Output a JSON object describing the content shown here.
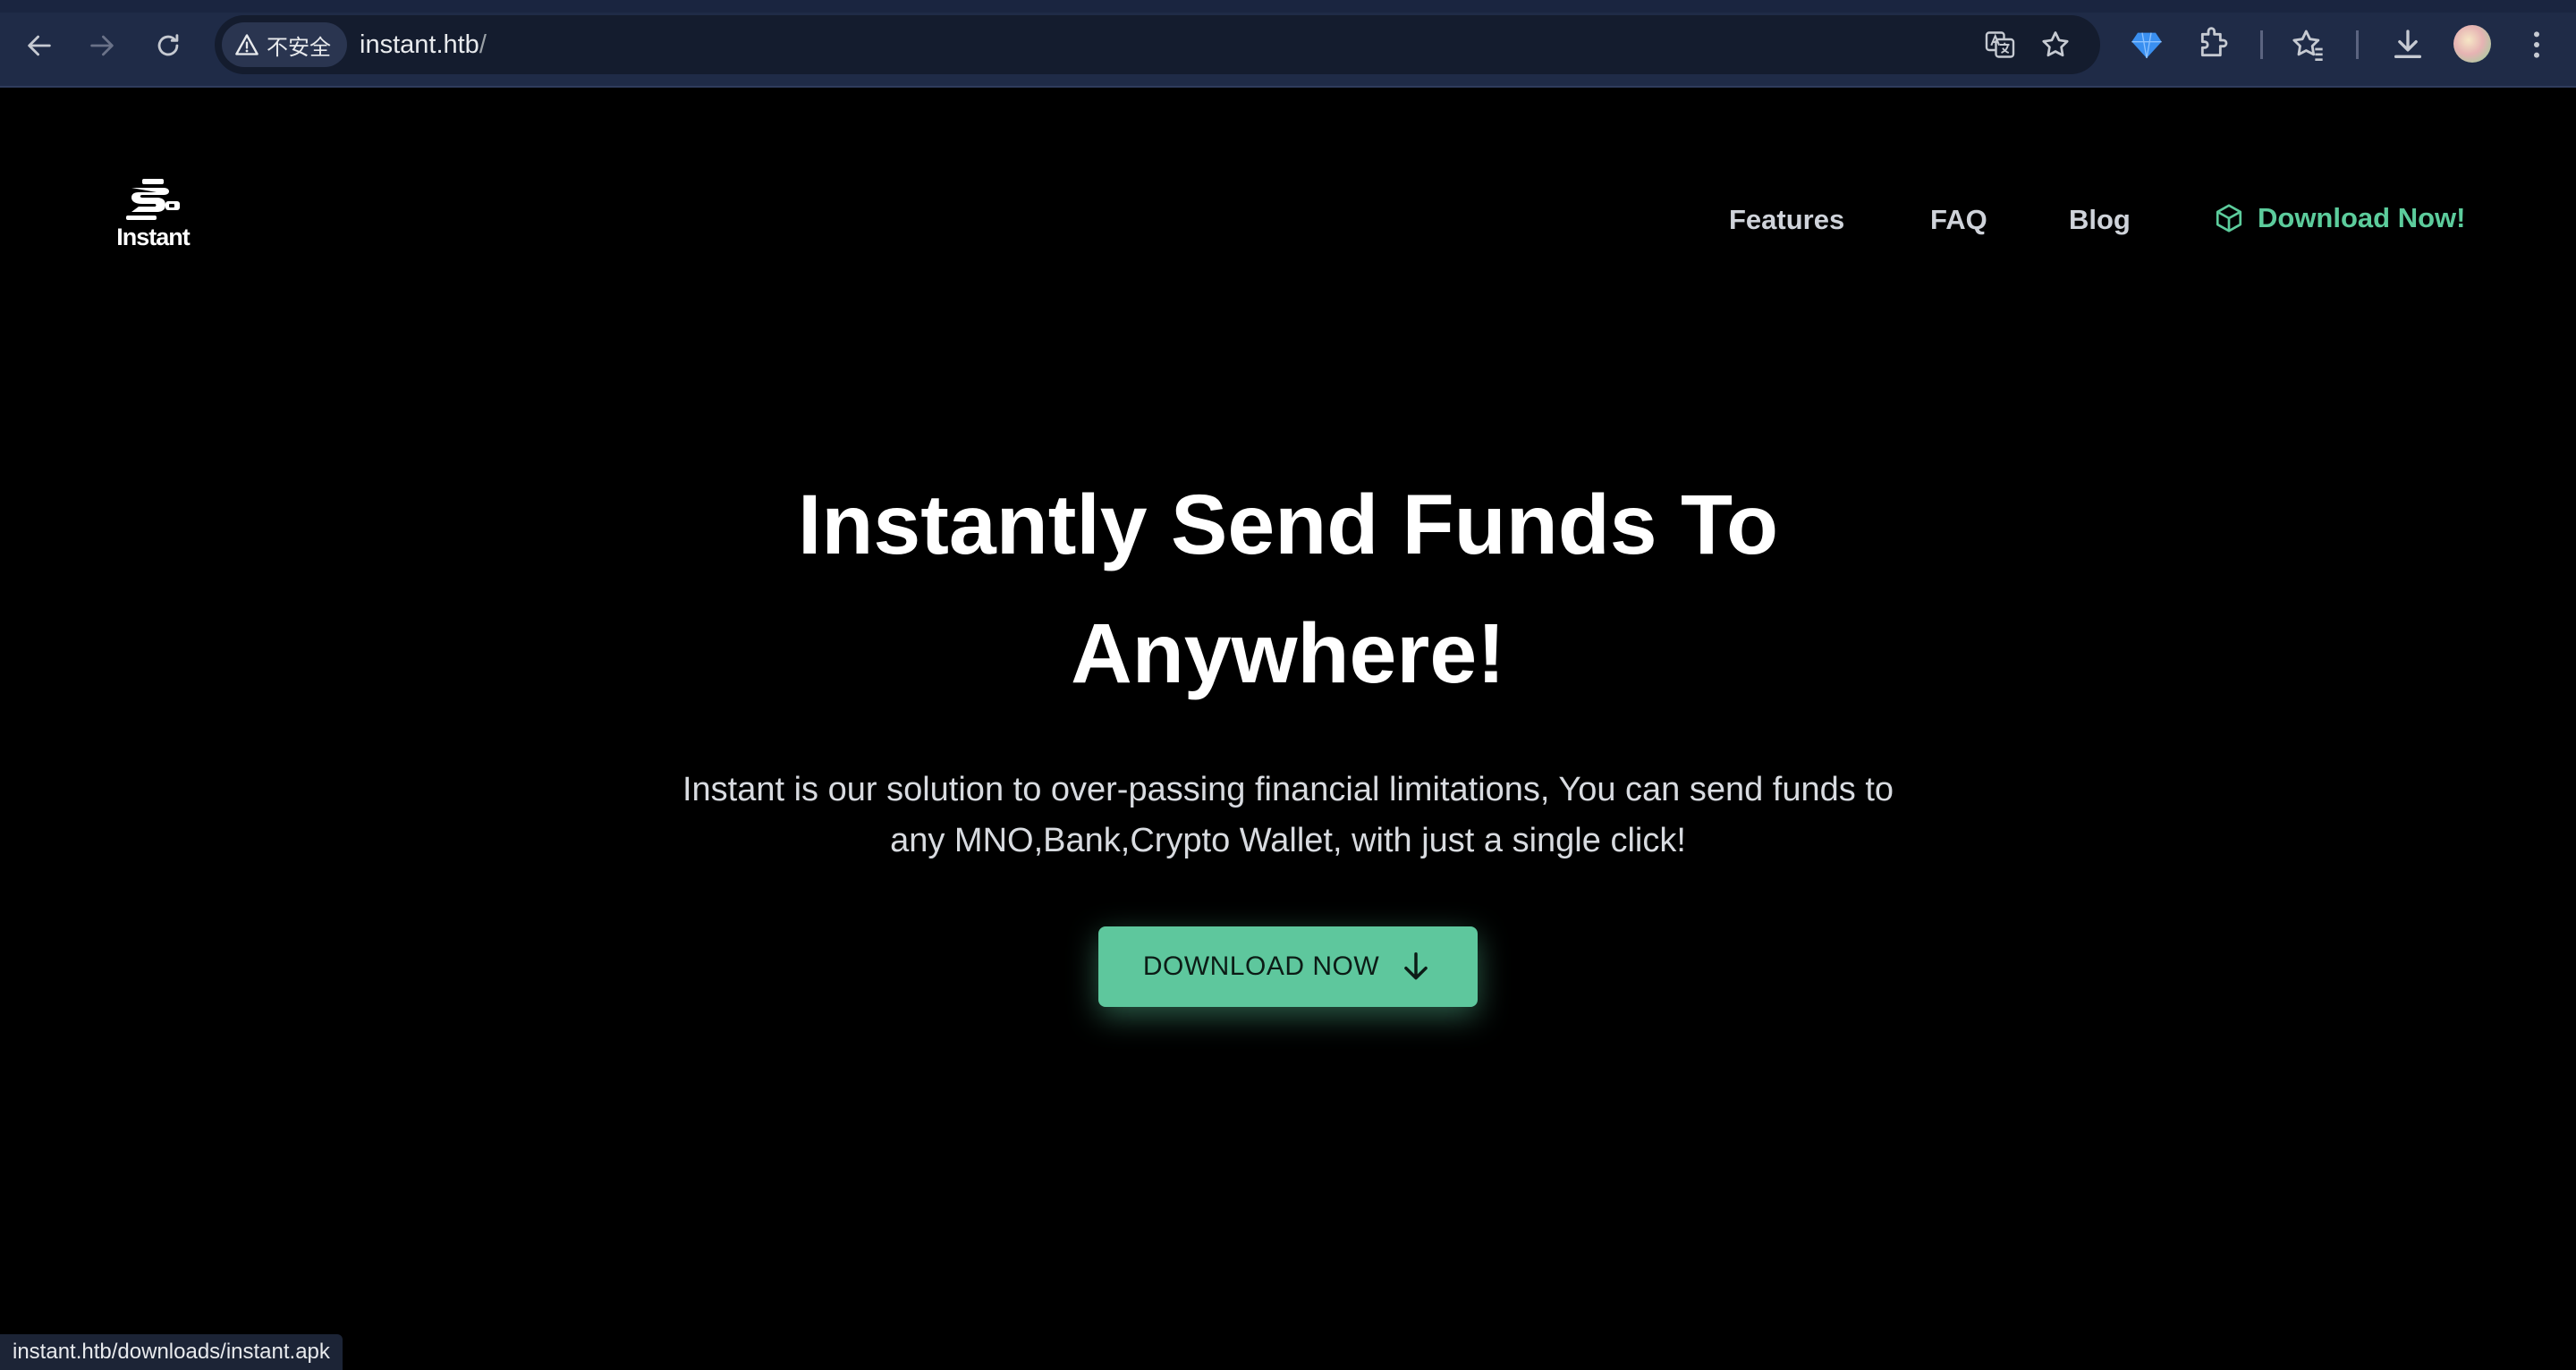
{
  "browser": {
    "security_label": "不安全",
    "url_host": "instant.htb",
    "url_path": "/",
    "status_url": "instant.htb/downloads/instant.apk"
  },
  "site": {
    "logo_text": "Instant",
    "nav": [
      "Features",
      "FAQ",
      "Blog"
    ],
    "cta_label": "Download Now!"
  },
  "hero": {
    "title_line1": "Instantly Send Funds To",
    "title_line2": "Anywhere!",
    "subtitle_line1": "Instant is our solution to over-passing financial limitations, You can send funds to",
    "subtitle_line2": "any MNO,Bank,Crypto Wallet, with just a single click!",
    "button_label": "DOWNLOAD NOW"
  },
  "colors": {
    "accent": "#5ec79d",
    "background": "#000000",
    "chrome": "#1f2b47"
  }
}
